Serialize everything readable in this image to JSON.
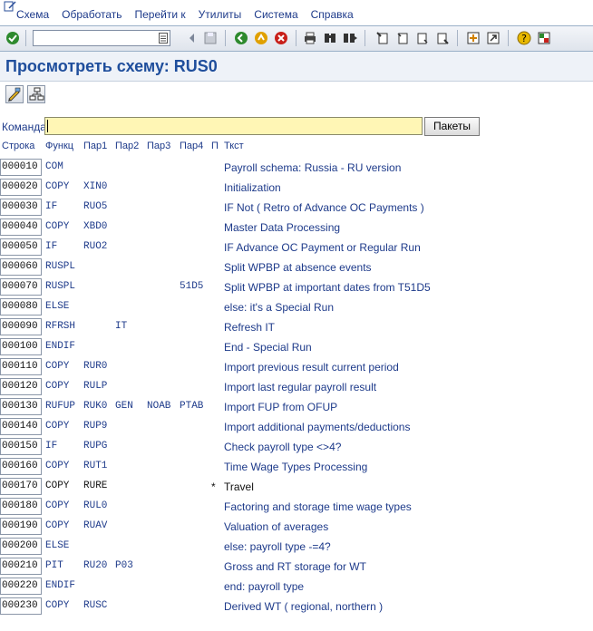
{
  "menu": {
    "items": [
      "Схема",
      "Обработать",
      "Перейти к",
      "Утилиты",
      "Система",
      "Справка"
    ]
  },
  "toolbar": {
    "command_value": "",
    "icons": [
      "check-icon",
      "back-icon",
      "save-icon",
      "nav-back-icon",
      "exit-icon",
      "cancel-icon",
      "print-icon",
      "find-icon",
      "find-next-icon",
      "first-page-icon",
      "prev-page-icon",
      "next-page-icon",
      "last-page-icon",
      "new-session-icon",
      "shortcut-icon",
      "help-icon",
      "layout-icon"
    ]
  },
  "title": "Просмотреть схему: RUS0",
  "app_toolbar": {
    "icons": [
      "edit-pencil-icon",
      "hierarchy-icon"
    ]
  },
  "command_line": {
    "label": "Команда",
    "value": "",
    "button": "Пакеты"
  },
  "table": {
    "headers": [
      "Строка",
      "Функц",
      "Пар1",
      "Пар2",
      "Пар3",
      "Пар4",
      "П",
      "Ткст"
    ],
    "rows": [
      {
        "line": "000010",
        "func": "COM",
        "p1": "",
        "p2": "",
        "p3": "",
        "p4": "",
        "d": "",
        "text": "Payroll schema: Russia - RU version"
      },
      {
        "line": "000020",
        "func": "COPY",
        "p1": "XIN0",
        "p2": "",
        "p3": "",
        "p4": "",
        "d": "",
        "text": "Initialization"
      },
      {
        "line": "000030",
        "func": "IF",
        "p1": "RUO5",
        "p2": "",
        "p3": "",
        "p4": "",
        "d": "",
        "text": "IF Not ( Retro of Advance OC Payments )"
      },
      {
        "line": "000040",
        "func": "COPY",
        "p1": "XBD0",
        "p2": "",
        "p3": "",
        "p4": "",
        "d": "",
        "text": "Master Data Processing"
      },
      {
        "line": "000050",
        "func": "IF",
        "p1": "RUO2",
        "p2": "",
        "p3": "",
        "p4": "",
        "d": "",
        "text": "IF Advance OC Payment or Regular Run"
      },
      {
        "line": "000060",
        "func": "RUSPL",
        "p1": "",
        "p2": "",
        "p3": "",
        "p4": "",
        "d": "",
        "text": "Split WPBP at absence events"
      },
      {
        "line": "000070",
        "func": "RUSPL",
        "p1": "",
        "p2": "",
        "p3": "",
        "p4": "51D5",
        "d": "",
        "text": "Split WPBP at important dates from T51D5"
      },
      {
        "line": "000080",
        "func": "ELSE",
        "p1": "",
        "p2": "",
        "p3": "",
        "p4": "",
        "d": "",
        "text": "else: it's a Special Run"
      },
      {
        "line": "000090",
        "func": "RFRSH",
        "p1": "",
        "p2": "IT",
        "p3": "",
        "p4": "",
        "d": "",
        "text": "Refresh IT"
      },
      {
        "line": "000100",
        "func": "ENDIF",
        "p1": "",
        "p2": "",
        "p3": "",
        "p4": "",
        "d": "",
        "text": "End - Special Run"
      },
      {
        "line": "000110",
        "func": "COPY",
        "p1": "RUR0",
        "p2": "",
        "p3": "",
        "p4": "",
        "d": "",
        "text": "Import previous result current period"
      },
      {
        "line": "000120",
        "func": "COPY",
        "p1": "RULP",
        "p2": "",
        "p3": "",
        "p4": "",
        "d": "",
        "text": "Import last regular payroll result"
      },
      {
        "line": "000130",
        "func": "RUFUP",
        "p1": "RUK0",
        "p2": "GEN",
        "p3": "NOAB",
        "p4": "PTAB",
        "d": "",
        "text": "Import FUP from OFUP"
      },
      {
        "line": "000140",
        "func": "COPY",
        "p1": "RUP9",
        "p2": "",
        "p3": "",
        "p4": "",
        "d": "",
        "text": "Import additional payments/deductions"
      },
      {
        "line": "000150",
        "func": "IF",
        "p1": "RUPG",
        "p2": "",
        "p3": "",
        "p4": "",
        "d": "",
        "text": "Check payroll type <>4?"
      },
      {
        "line": "000160",
        "func": "COPY",
        "p1": "RUT1",
        "p2": "",
        "p3": "",
        "p4": "",
        "d": "",
        "text": "Time Wage Types Processing"
      },
      {
        "line": "000170",
        "func": "COPY",
        "p1": "RURE",
        "p2": "",
        "p3": "",
        "p4": "",
        "d": "*",
        "text": "Travel"
      },
      {
        "line": "000180",
        "func": "COPY",
        "p1": "RUL0",
        "p2": "",
        "p3": "",
        "p4": "",
        "d": "",
        "text": "Factoring and storage time wage types"
      },
      {
        "line": "000190",
        "func": "COPY",
        "p1": "RUAV",
        "p2": "",
        "p3": "",
        "p4": "",
        "d": "",
        "text": "Valuation of averages"
      },
      {
        "line": "000200",
        "func": "ELSE",
        "p1": "",
        "p2": "",
        "p3": "",
        "p4": "",
        "d": "",
        "text": "else:  payroll type -=4?"
      },
      {
        "line": "000210",
        "func": "PIT",
        "p1": "RU20",
        "p2": "P03",
        "p3": "",
        "p4": "",
        "d": "",
        "text": "Gross and RT storage for WT"
      },
      {
        "line": "000220",
        "func": "ENDIF",
        "p1": "",
        "p2": "",
        "p3": "",
        "p4": "",
        "d": "",
        "text": "end: payroll type"
      },
      {
        "line": "000230",
        "func": "COPY",
        "p1": "RUSC",
        "p2": "",
        "p3": "",
        "p4": "",
        "d": "",
        "text": "Derived WT ( regional, northern )"
      }
    ]
  },
  "colors": {
    "accent_text": "#1d3a8a",
    "title": "#1f4e9c",
    "command_input_bg": "#fff6b5",
    "inactive_text": "#111111"
  }
}
